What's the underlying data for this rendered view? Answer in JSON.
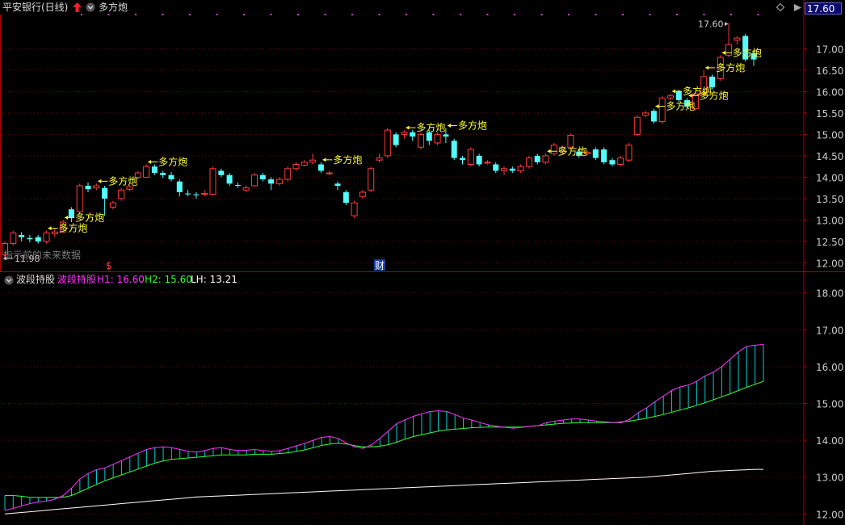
{
  "colors": {
    "background": "#000000",
    "up": "#ff3b3b",
    "down": "#54fcfc",
    "frame": "#b00000",
    "grid": "#7a0000",
    "tick_text": "#cccccc",
    "signal": "#ffff33",
    "marker": "#ff33ff",
    "h1": "#ff33ff",
    "h2": "#33ff33",
    "lh": "#ffffff",
    "fill": "#00cccc"
  },
  "header": {
    "stock_name": "平安银行(日线)",
    "up_arrow_icon": "red-up-arrow-icon",
    "dropdown_icon": "chevron-down-icon",
    "indicator_name": "多方炮",
    "price_box": "17.60",
    "diamond_icon": "diamond-icon"
  },
  "main_chart": {
    "y_ticks": [
      "17.00",
      "16.50",
      "16.00",
      "15.50",
      "15.00",
      "14.50",
      "14.00",
      "13.50",
      "13.00",
      "12.50",
      "12.00"
    ],
    "high_label": "17.60",
    "low_label": "11.98",
    "footer_note": "指示前的未来数据",
    "event_s": "$",
    "event_cai": "财",
    "signal_label": "多方炮"
  },
  "sub_chart": {
    "title": "波段持股",
    "legend_name": "波段持股",
    "h1_label": "H1: 16.60",
    "h2_label": "H2: 15.60",
    "lh_label": "LH: 13.21",
    "y_ticks": [
      "18.00",
      "17.00",
      "16.00",
      "15.00",
      "14.00",
      "13.00",
      "12.00"
    ]
  },
  "chart_data": [
    {
      "type": "candlestick",
      "y_axis": [
        11.8,
        17.8
      ],
      "grid": true,
      "candles": [
        [
          12.2,
          12.45,
          12.5,
          12.1
        ],
        [
          12.45,
          12.7,
          12.75,
          12.4
        ],
        [
          12.65,
          12.6,
          12.72,
          12.5
        ],
        [
          12.58,
          12.55,
          12.65,
          12.48
        ],
        [
          12.6,
          12.5,
          12.65,
          12.45
        ],
        [
          12.5,
          12.7,
          12.75,
          12.45
        ],
        [
          12.68,
          12.72,
          12.8,
          12.6
        ],
        [
          12.72,
          12.95,
          13.0,
          12.7
        ],
        [
          13.25,
          13.05,
          13.3,
          12.95
        ],
        [
          13.2,
          13.8,
          13.85,
          13.15
        ],
        [
          13.8,
          13.72,
          13.88,
          13.65
        ],
        [
          13.75,
          13.8,
          13.85,
          13.7
        ],
        [
          13.75,
          13.5,
          13.8,
          13.1
        ],
        [
          13.3,
          13.4,
          13.45,
          13.25
        ],
        [
          13.5,
          13.7,
          13.75,
          13.45
        ],
        [
          13.72,
          13.78,
          13.82,
          13.68
        ],
        [
          14.0,
          14.1,
          14.15,
          13.95
        ],
        [
          14.0,
          14.25,
          14.3,
          13.98
        ],
        [
          14.25,
          14.1,
          14.3,
          14.05
        ],
        [
          14.1,
          14.05,
          14.15,
          13.98
        ],
        [
          14.05,
          13.95,
          14.12,
          13.9
        ],
        [
          13.9,
          13.65,
          13.95,
          13.55
        ],
        [
          13.62,
          13.6,
          13.7,
          13.55
        ],
        [
          13.6,
          13.58,
          13.65,
          13.5
        ],
        [
          13.6,
          13.62,
          13.7,
          13.55
        ],
        [
          13.6,
          14.2,
          14.25,
          13.58
        ],
        [
          14.15,
          14.05,
          14.2,
          14.0
        ],
        [
          14.05,
          13.85,
          14.1,
          13.8
        ],
        [
          13.82,
          13.8,
          13.88,
          13.75
        ],
        [
          13.7,
          13.75,
          13.8,
          13.65
        ],
        [
          13.8,
          14.05,
          14.1,
          13.78
        ],
        [
          14.05,
          13.95,
          14.1,
          13.9
        ],
        [
          13.95,
          13.85,
          14.0,
          13.7
        ],
        [
          13.85,
          13.95,
          14.0,
          13.8
        ],
        [
          13.95,
          14.2,
          14.25,
          13.9
        ],
        [
          14.2,
          14.3,
          14.35,
          14.15
        ],
        [
          14.28,
          14.35,
          14.4,
          14.25
        ],
        [
          14.35,
          14.4,
          14.55,
          14.3
        ],
        [
          14.3,
          14.15,
          14.35,
          14.1
        ],
        [
          14.1,
          14.1,
          14.15,
          14.05
        ],
        [
          13.85,
          13.8,
          13.9,
          13.7
        ],
        [
          13.65,
          13.4,
          13.7,
          13.35
        ],
        [
          13.1,
          13.4,
          13.45,
          13.05
        ],
        [
          13.55,
          13.65,
          13.7,
          13.5
        ],
        [
          13.7,
          14.2,
          14.25,
          13.65
        ],
        [
          14.4,
          14.45,
          14.55,
          14.35
        ],
        [
          14.5,
          15.1,
          15.15,
          14.45
        ],
        [
          15.0,
          14.75,
          15.05,
          14.7
        ],
        [
          15.0,
          15.05,
          15.1,
          14.9
        ],
        [
          15.05,
          14.95,
          15.1,
          14.85
        ],
        [
          14.7,
          15.0,
          15.05,
          14.65
        ],
        [
          15.05,
          14.85,
          15.1,
          14.75
        ],
        [
          14.8,
          15.0,
          15.05,
          14.75
        ],
        [
          15.0,
          14.95,
          15.15,
          14.8
        ],
        [
          14.85,
          14.45,
          14.9,
          14.4
        ],
        [
          14.45,
          14.4,
          14.5,
          14.3
        ],
        [
          14.3,
          14.65,
          14.7,
          14.25
        ],
        [
          14.5,
          14.3,
          14.55,
          14.25
        ],
        [
          14.35,
          14.35,
          14.4,
          14.3
        ],
        [
          14.3,
          14.15,
          14.35,
          14.1
        ],
        [
          14.15,
          14.2,
          14.25,
          14.05
        ],
        [
          14.2,
          14.15,
          14.25,
          14.1
        ],
        [
          14.15,
          14.25,
          14.3,
          14.1
        ],
        [
          14.25,
          14.45,
          14.5,
          14.2
        ],
        [
          14.5,
          14.35,
          14.55,
          14.3
        ],
        [
          14.35,
          14.5,
          14.55,
          14.3
        ],
        [
          14.55,
          14.75,
          14.8,
          14.5
        ],
        [
          14.6,
          14.7,
          14.75,
          14.55
        ],
        [
          14.7,
          14.98,
          15.02,
          14.65
        ],
        [
          14.6,
          14.5,
          14.65,
          14.45
        ],
        [
          14.55,
          14.58,
          14.62,
          14.5
        ],
        [
          14.65,
          14.45,
          14.7,
          14.4
        ],
        [
          14.65,
          14.35,
          14.7,
          14.3
        ],
        [
          14.4,
          14.3,
          14.45,
          14.25
        ],
        [
          14.3,
          14.45,
          14.5,
          14.25
        ],
        [
          14.4,
          14.75,
          14.8,
          14.35
        ],
        [
          15.0,
          15.4,
          15.45,
          14.95
        ],
        [
          15.45,
          15.5,
          15.55,
          15.4
        ],
        [
          15.55,
          15.3,
          15.6,
          15.25
        ],
        [
          15.3,
          15.85,
          15.9,
          15.25
        ],
        [
          15.85,
          15.9,
          15.95,
          15.8
        ],
        [
          16.0,
          15.8,
          16.05,
          15.75
        ],
        [
          15.8,
          15.65,
          15.85,
          15.6
        ],
        [
          15.6,
          15.95,
          16.0,
          15.55
        ],
        [
          15.95,
          16.35,
          16.5,
          15.9
        ],
        [
          16.35,
          16.1,
          16.4,
          16.05
        ],
        [
          16.3,
          16.8,
          16.85,
          16.25
        ],
        [
          16.85,
          17.1,
          17.6,
          16.8
        ],
        [
          17.2,
          17.25,
          17.3,
          17.1
        ],
        [
          17.3,
          16.75,
          17.35,
          16.7
        ],
        [
          16.9,
          16.75,
          16.95,
          16.6
        ]
      ],
      "signals": [
        5,
        7,
        11,
        17,
        38,
        48,
        53,
        65,
        78,
        80,
        82,
        84,
        86
      ]
    },
    {
      "type": "band",
      "name": "波段持股",
      "y_axis": [
        11.7,
        18.3
      ],
      "grid": true,
      "h1": [
        12.1,
        12.15,
        12.22,
        12.28,
        12.32,
        12.35,
        12.4,
        12.5,
        12.7,
        12.95,
        13.1,
        13.2,
        13.25,
        13.35,
        13.45,
        13.55,
        13.65,
        13.75,
        13.8,
        13.82,
        13.8,
        13.75,
        13.7,
        13.68,
        13.72,
        13.78,
        13.8,
        13.75,
        13.72,
        13.73,
        13.75,
        13.72,
        13.7,
        13.72,
        13.78,
        13.85,
        13.92,
        14.0,
        14.08,
        14.1,
        14.05,
        13.92,
        13.82,
        13.78,
        13.88,
        14.05,
        14.25,
        14.45,
        14.55,
        14.65,
        14.72,
        14.78,
        14.8,
        14.78,
        14.7,
        14.6,
        14.55,
        14.48,
        14.42,
        14.38,
        14.35,
        14.33,
        14.35,
        14.38,
        14.4,
        14.48,
        14.52,
        14.55,
        14.58,
        14.58,
        14.55,
        14.52,
        14.5,
        14.48,
        14.48,
        14.58,
        14.75,
        14.88,
        15.05,
        15.2,
        15.35,
        15.45,
        15.5,
        15.6,
        15.75,
        15.85,
        16.0,
        16.2,
        16.4,
        16.55,
        16.58,
        16.6
      ],
      "h2": [
        12.5,
        12.5,
        12.48,
        12.45,
        12.45,
        12.45,
        12.45,
        12.45,
        12.5,
        12.6,
        12.7,
        12.8,
        12.9,
        12.98,
        13.06,
        13.14,
        13.22,
        13.3,
        13.38,
        13.44,
        13.48,
        13.5,
        13.52,
        13.54,
        13.56,
        13.58,
        13.6,
        13.6,
        13.6,
        13.6,
        13.62,
        13.62,
        13.62,
        13.64,
        13.66,
        13.7,
        13.74,
        13.8,
        13.86,
        13.9,
        13.92,
        13.9,
        13.85,
        13.82,
        13.82,
        13.84,
        13.88,
        13.95,
        14.03,
        14.1,
        14.15,
        14.2,
        14.25,
        14.28,
        14.3,
        14.32,
        14.34,
        14.35,
        14.36,
        14.36,
        14.36,
        14.36,
        14.36,
        14.38,
        14.4,
        14.42,
        14.44,
        14.46,
        14.47,
        14.48,
        14.48,
        14.48,
        14.48,
        14.48,
        14.5,
        14.52,
        14.56,
        14.6,
        14.65,
        14.7,
        14.76,
        14.82,
        14.88,
        14.95,
        15.02,
        15.1,
        15.18,
        15.26,
        15.35,
        15.44,
        15.52,
        15.6
      ],
      "lh": [
        12.0,
        12.02,
        12.04,
        12.06,
        12.08,
        12.1,
        12.12,
        12.14,
        12.16,
        12.18,
        12.2,
        12.22,
        12.24,
        12.26,
        12.28,
        12.3,
        12.32,
        12.34,
        12.36,
        12.38,
        12.4,
        12.42,
        12.44,
        12.46,
        12.47,
        12.48,
        12.49,
        12.5,
        12.51,
        12.52,
        12.53,
        12.54,
        12.55,
        12.56,
        12.57,
        12.58,
        12.59,
        12.6,
        12.61,
        12.62,
        12.63,
        12.64,
        12.65,
        12.66,
        12.67,
        12.68,
        12.69,
        12.7,
        12.71,
        12.72,
        12.73,
        12.74,
        12.75,
        12.76,
        12.77,
        12.78,
        12.79,
        12.8,
        12.81,
        12.82,
        12.83,
        12.84,
        12.85,
        12.86,
        12.87,
        12.88,
        12.89,
        12.9,
        12.91,
        12.92,
        12.93,
        12.94,
        12.95,
        12.96,
        12.97,
        12.98,
        12.99,
        13.0,
        13.02,
        13.04,
        13.06,
        13.08,
        13.1,
        13.12,
        13.14,
        13.16,
        13.17,
        13.18,
        13.19,
        13.2,
        13.21,
        13.21
      ]
    }
  ]
}
